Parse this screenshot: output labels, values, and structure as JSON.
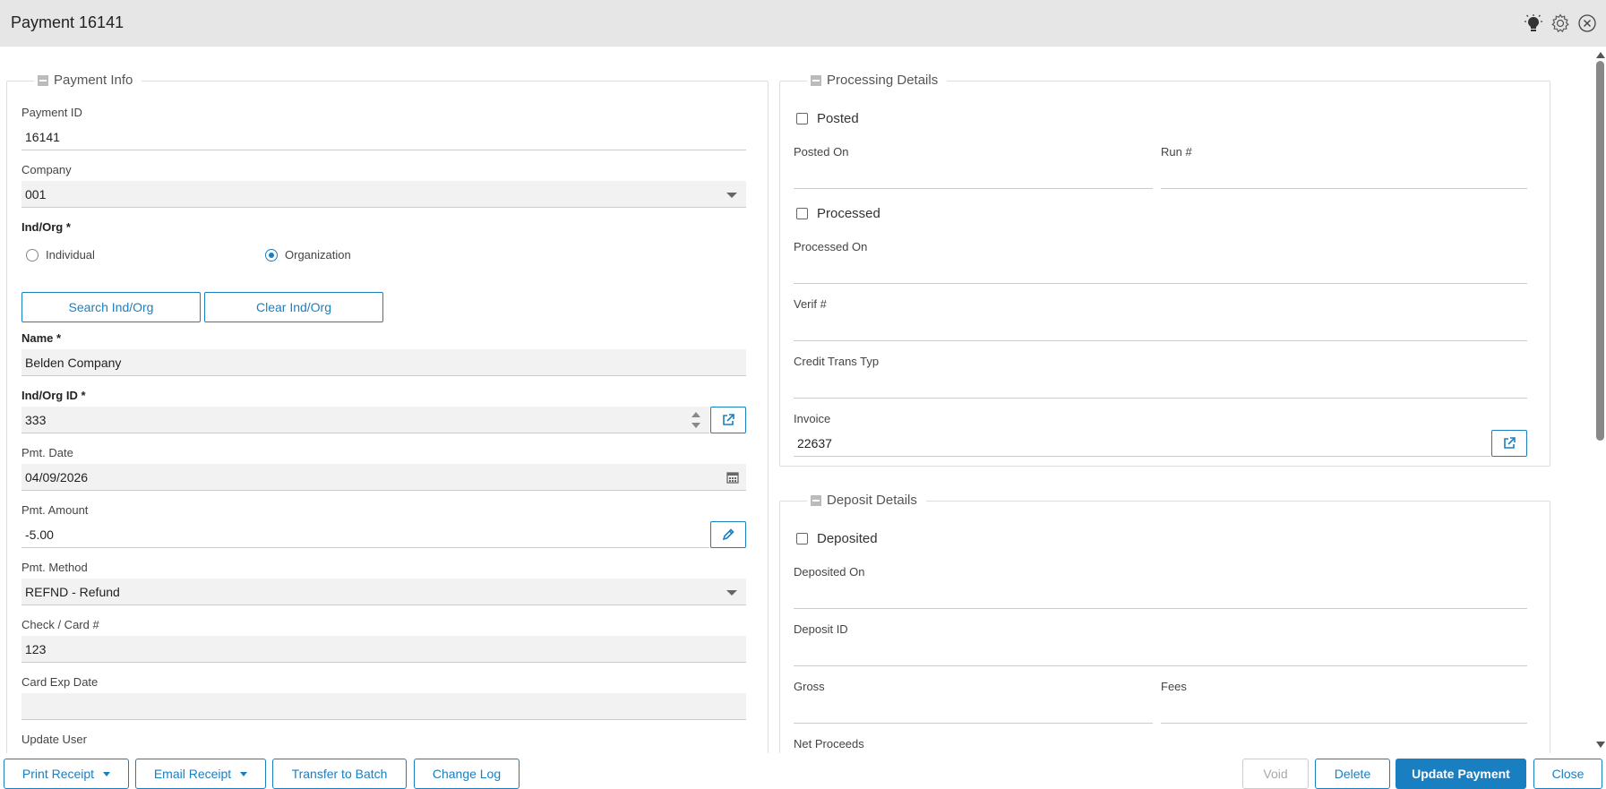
{
  "window": {
    "title": "Payment 16141"
  },
  "payment_info": {
    "legend": "Payment Info",
    "payment_id": {
      "label": "Payment ID",
      "value": "16141"
    },
    "company": {
      "label": "Company",
      "value": "001"
    },
    "ind_org": {
      "label": "Ind/Org *",
      "options": [
        "Individual",
        "Organization"
      ],
      "selected": "Organization"
    },
    "search_btn": "Search Ind/Org",
    "clear_btn": "Clear Ind/Org",
    "name": {
      "label": "Name *",
      "value": "Belden Company"
    },
    "ind_org_id": {
      "label": "Ind/Org ID *",
      "value": "333"
    },
    "pmt_date": {
      "label": "Pmt. Date",
      "value": "04/09/2026"
    },
    "pmt_amount": {
      "label": "Pmt. Amount",
      "value": "-5.00"
    },
    "pmt_method": {
      "label": "Pmt. Method",
      "value": "REFND - Refund"
    },
    "check_card": {
      "label": "Check / Card #",
      "value": "123"
    },
    "card_exp": {
      "label": "Card Exp Date",
      "value": ""
    },
    "update_user": {
      "label": "Update User"
    }
  },
  "processing": {
    "legend": "Processing Details",
    "posted": "Posted",
    "posted_on": "Posted On",
    "run_no": "Run #",
    "processed": "Processed",
    "processed_on": "Processed On",
    "verif": "Verif #",
    "credit_trans_typ": "Credit Trans Typ",
    "invoice": {
      "label": "Invoice",
      "value": "22637"
    }
  },
  "deposit": {
    "legend": "Deposit Details",
    "deposited": "Deposited",
    "deposited_on": "Deposited On",
    "deposit_id": "Deposit ID",
    "gross": "Gross",
    "fees": "Fees",
    "net_proceeds": "Net Proceeds"
  },
  "footer": {
    "print_receipt": "Print Receipt",
    "email_receipt": "Email Receipt",
    "transfer_batch": "Transfer to Batch",
    "change_log": "Change Log",
    "void": "Void",
    "delete": "Delete",
    "update_payment": "Update Payment",
    "close": "Close"
  },
  "colors": {
    "accent": "#1a7fc1",
    "titlebar": "#e6e6e6"
  }
}
